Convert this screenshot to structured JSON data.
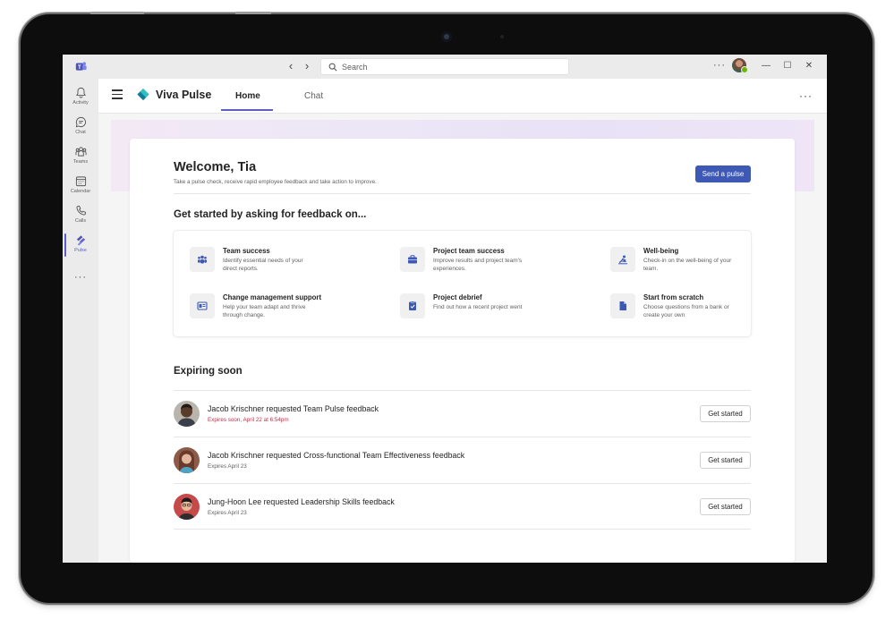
{
  "titlebar": {
    "search_placeholder": "Search"
  },
  "rail": {
    "items": [
      {
        "label": "Activity",
        "icon": "bell-icon"
      },
      {
        "label": "Chat",
        "icon": "chat-icon"
      },
      {
        "label": "Teams",
        "icon": "teams-icon"
      },
      {
        "label": "Calendar",
        "icon": "calendar-icon"
      },
      {
        "label": "Calls",
        "icon": "phone-icon"
      },
      {
        "label": "Pulse",
        "icon": "pulse-icon"
      }
    ],
    "active": "Pulse"
  },
  "app": {
    "name": "Viva Pulse",
    "tabs": [
      {
        "label": "Home"
      },
      {
        "label": "Chat"
      }
    ],
    "active_tab": "Home"
  },
  "welcome": {
    "title": "Welcome, Tia",
    "subtitle": "Take a pulse check, receive rapid employee feedback and take action to improve.",
    "send_button": "Send a pulse"
  },
  "get_started": {
    "title": "Get started by asking for feedback on...",
    "options": [
      {
        "title": "Team success",
        "desc": "Identify essential needs of your direct reports.",
        "icon": "people-icon"
      },
      {
        "title": "Project team success",
        "desc": "Improve results and project team's experiences.",
        "icon": "briefcase-icon"
      },
      {
        "title": "Well-being",
        "desc": "Check-in on the well-being of your team.",
        "icon": "wellbeing-icon"
      },
      {
        "title": "Change management support",
        "desc": "Help your team adapt and thrive through change.",
        "icon": "change-icon"
      },
      {
        "title": "Project debrief",
        "desc": "Find out how a recent project went",
        "icon": "clipboard-check-icon"
      },
      {
        "title": "Start from scratch",
        "desc": "Choose questions from a bank or create your own",
        "icon": "document-icon"
      }
    ]
  },
  "expiring": {
    "title": "Expiring soon",
    "items": [
      {
        "title": "Jacob Krischner requested Team Pulse feedback",
        "sub": "Expires soon, April 22 at 6:54pm",
        "warning": true,
        "button": "Get started"
      },
      {
        "title": "Jacob Krischner requested Cross-functional Team Effectiveness feedback",
        "sub": "Expires April 23",
        "warning": false,
        "button": "Get started"
      },
      {
        "title": "Jung-Hoon Lee requested Leadership Skills feedback",
        "sub": "Expires April 23",
        "warning": false,
        "button": "Get started"
      }
    ]
  },
  "colors": {
    "accent": "#5b5fc7",
    "primary_button": "#3d58b5",
    "warning_text": "#c4314b",
    "option_icon": "#3d58b5"
  }
}
